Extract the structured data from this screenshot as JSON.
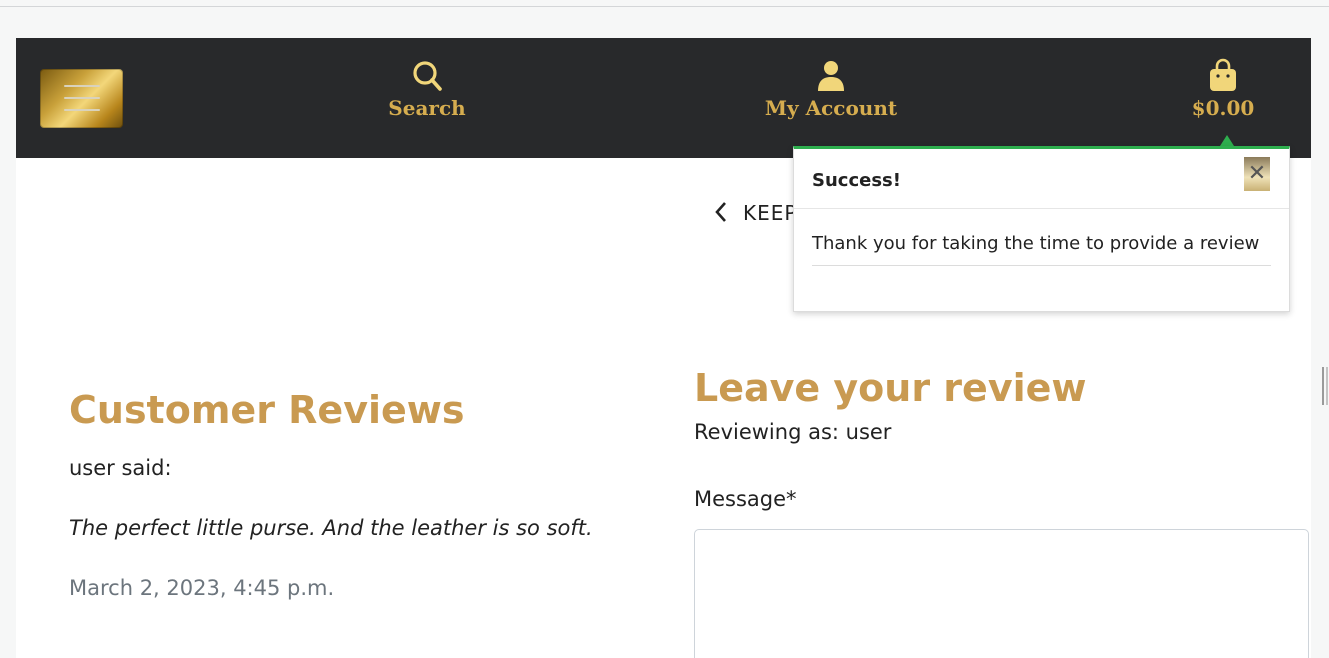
{
  "navbar": {
    "search_label": "Search",
    "account_label": "My Account",
    "cart_total": "$0.00",
    "accent_color": "#d6ad4f"
  },
  "toast": {
    "title": "Success!",
    "message": "Thank you for taking the time to provide a review",
    "close_glyph": "✕",
    "status_color": "#2eae4e"
  },
  "back_link": {
    "label": "KEEP"
  },
  "reviews": {
    "heading": "Customer Reviews",
    "items": [
      {
        "author_line": "user said:",
        "text": "The perfect little purse. And the leather is so soft.",
        "date": "March 2, 2023, 4:45 p.m."
      }
    ]
  },
  "review_form": {
    "heading": "Leave your review",
    "reviewing_as": "Reviewing as: user",
    "message_label": "Message*",
    "message_value": ""
  }
}
